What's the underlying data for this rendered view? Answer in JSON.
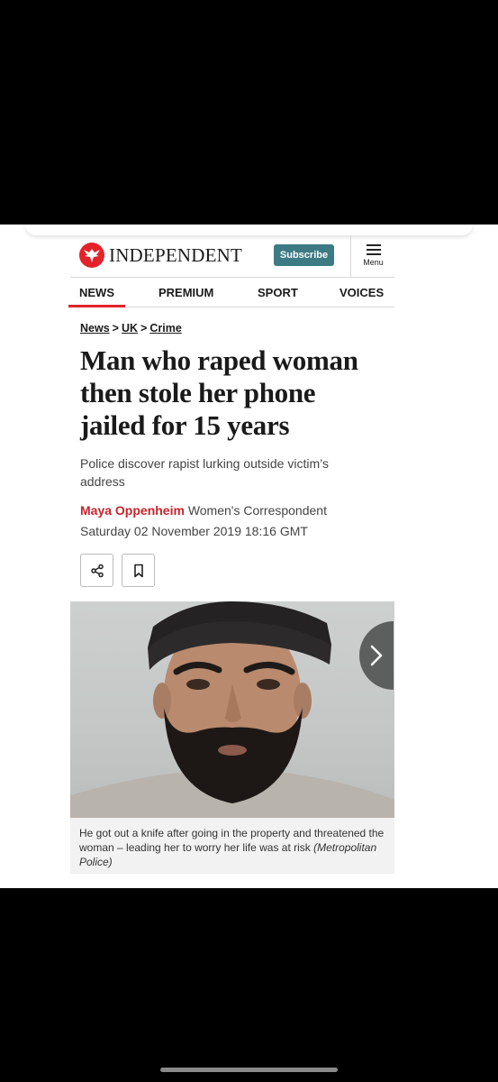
{
  "header": {
    "logo_text": "INDEPENDENT",
    "subscribe_label": "Subscribe",
    "menu_label": "Menu"
  },
  "nav": {
    "items": [
      "NEWS",
      "PREMIUM",
      "SPORT",
      "VOICES"
    ],
    "active": "NEWS"
  },
  "breadcrumb": {
    "items": [
      "News",
      "UK",
      "Crime"
    ],
    "separator": ">"
  },
  "article": {
    "headline": "Man who raped woman then stole her phone jailed for 15 years",
    "standfirst": "Police discover rapist lurking outside victim’s address",
    "author": "Maya Oppenheim",
    "author_role": "Women's Correspondent",
    "date": "Saturday 02 November 2019 18:16 GMT"
  },
  "actions": {
    "share_icon": "share-icon",
    "bookmark_icon": "bookmark-icon"
  },
  "photo": {
    "caption": "He got out a knife after going in the property and threatened the woman – leading her to worry her life was at risk",
    "credit": "(Metropolitan Police)"
  },
  "colors": {
    "brand_red": "#e3222a",
    "author_red": "#c8242b",
    "subscribe_bg": "#3c7a84"
  }
}
